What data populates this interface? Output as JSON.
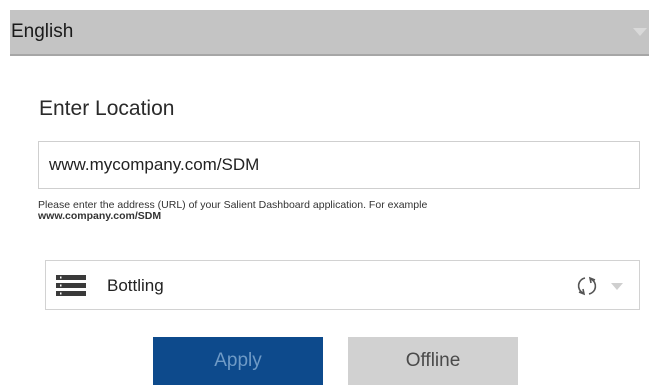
{
  "language_selector": {
    "selected": "English",
    "icon": "chevron-down-icon"
  },
  "location": {
    "heading": "Enter Location",
    "url_value": "www.mycompany.com/SDM",
    "help_text": "Please enter the address (URL) of your Salient Dashboard application. For example",
    "help_example": "www.company.com/SDM"
  },
  "dashboard_selector": {
    "selected": "Bottling",
    "icons": [
      "list-icon",
      "refresh-icon",
      "chevron-down-icon"
    ]
  },
  "actions": {
    "apply_label": "Apply",
    "offline_label": "Offline"
  },
  "colors": {
    "apply_bg": "#0d4a8c",
    "apply_text": "#6e9ac6",
    "offline_bg": "#d1d1d1",
    "lang_bar_bg": "#c4c4c4"
  }
}
